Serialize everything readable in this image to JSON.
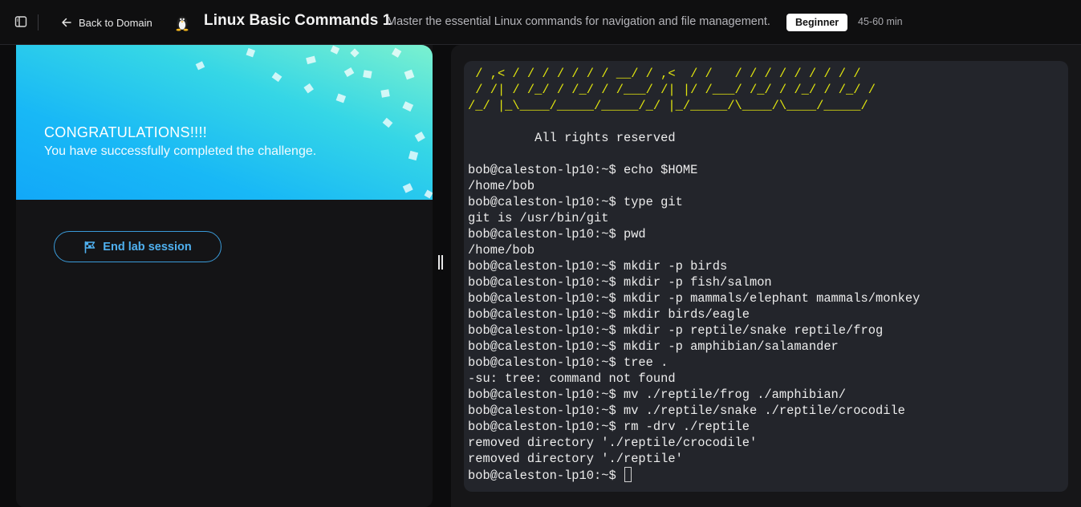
{
  "header": {
    "back_label": "Back to Domain",
    "course_title": "Linux Basic Commands 1",
    "course_description": "Master the essential Linux commands for navigation and file management.",
    "level": "Beginner",
    "duration": "45-60 min"
  },
  "banner": {
    "title": "CONGRATULATIONS!!!!",
    "subtitle": "You have successfully completed the challenge."
  },
  "actions": {
    "end_session_label": "End lab session"
  },
  "terminal": {
    "ascii_art": [
      " / ,< / / / / / / / __/ / ,<  / /   / / / / / / / / /",
      " / /| / /_/ / /_/ / /___/ /| |/ /___/ /_/ / /_/ / /_/ /",
      "/_/ |_\\____/_____/_____/_/ |_/_____/\\____/\\____/_____/"
    ],
    "lines": [
      "",
      "         All rights reserved",
      "",
      "bob@caleston-lp10:~$ echo $HOME",
      "/home/bob",
      "bob@caleston-lp10:~$ type git",
      "git is /usr/bin/git",
      "bob@caleston-lp10:~$ pwd",
      "/home/bob",
      "bob@caleston-lp10:~$ mkdir -p birds",
      "bob@caleston-lp10:~$ mkdir -p fish/salmon",
      "bob@caleston-lp10:~$ mkdir -p mammals/elephant mammals/monkey",
      "bob@caleston-lp10:~$ mkdir birds/eagle",
      "bob@caleston-lp10:~$ mkdir -p reptile/snake reptile/frog",
      "bob@caleston-lp10:~$ mkdir -p amphibian/salamander",
      "bob@caleston-lp10:~$ tree .",
      "-su: tree: command not found",
      "bob@caleston-lp10:~$ mv ./reptile/frog ./amphibian/",
      "bob@caleston-lp10:~$ mv ./reptile/snake ./reptile/crocodile",
      "bob@caleston-lp10:~$ rm -drv ./reptile",
      "removed directory './reptile/crocodile'",
      "removed directory './reptile'"
    ],
    "prompt": "bob@caleston-lp10:~$ "
  },
  "icons": {
    "sidebar_toggle": "sidebar-toggle-icon",
    "back": "arrow-left-icon",
    "course": "tux-penguin-icon",
    "end_session": "flag-icon"
  },
  "colors": {
    "ascii_art": "#dfe30f",
    "terminal_bg": "#23252b",
    "accent_blue": "#4fb0ef"
  }
}
